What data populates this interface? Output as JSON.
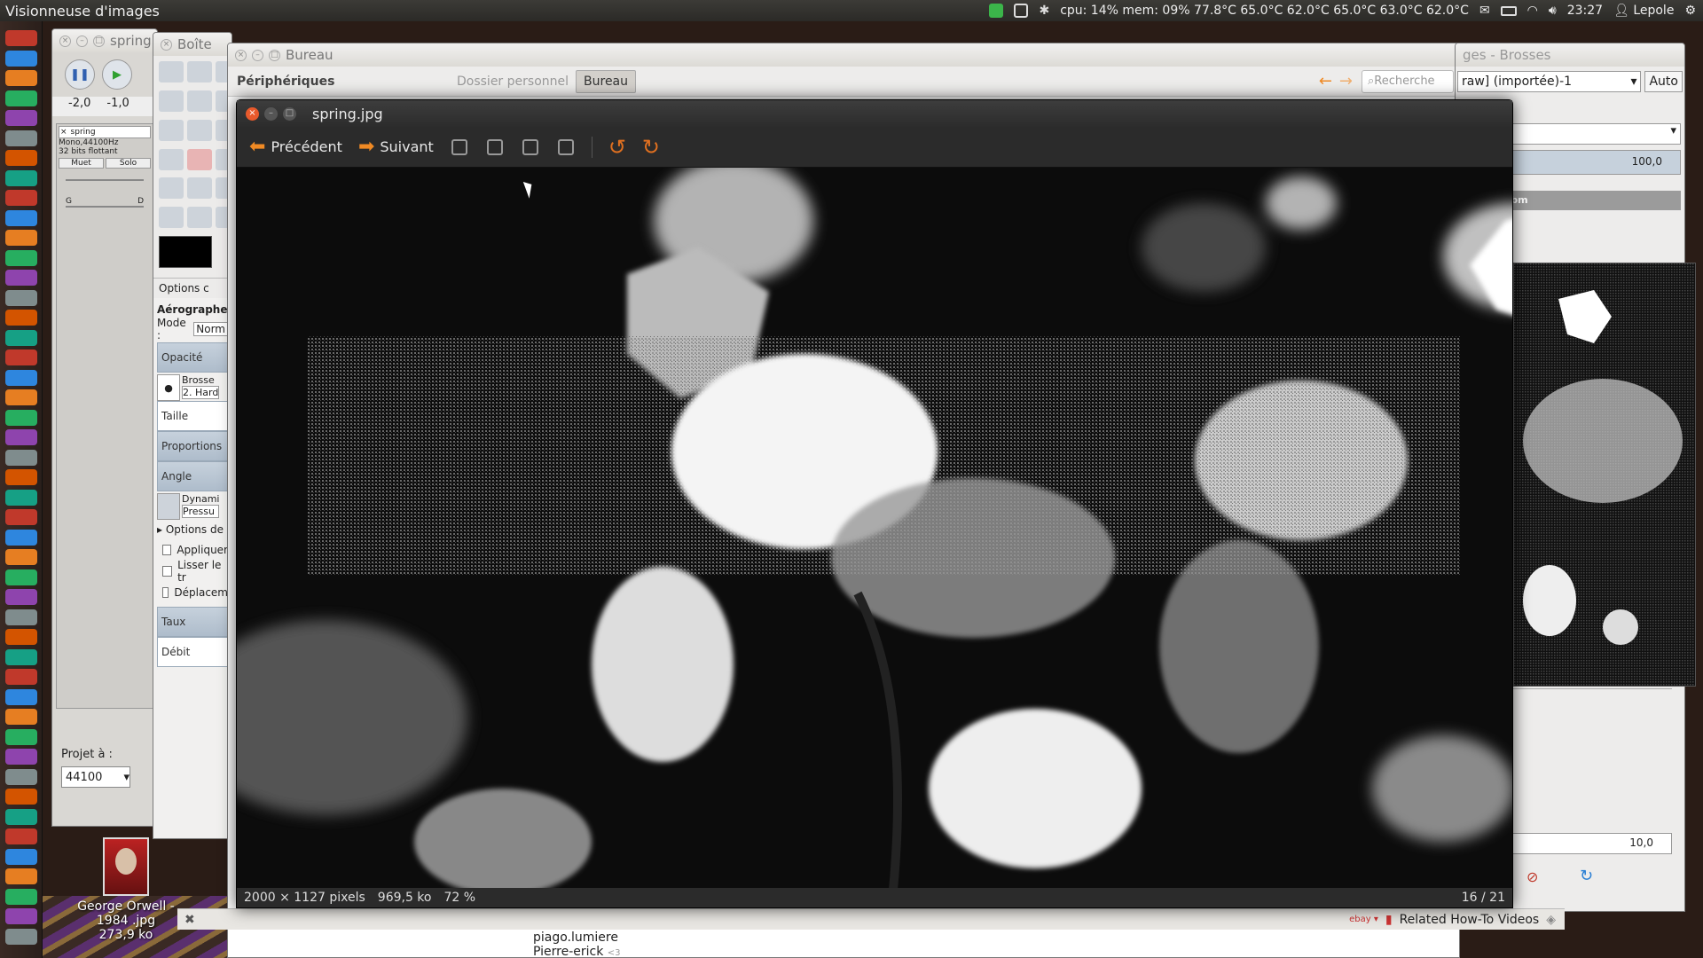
{
  "top_panel": {
    "app_name": "Visionneuse d'images",
    "system_stats": "cpu: 14% mem: 09% 77.8°C 65.0°C 62.0°C 65.0°C 63.0°C 62.0°C",
    "time": "23:27",
    "user": "Lepole"
  },
  "audacity": {
    "title": "spring",
    "ruler_left": "-2,0",
    "ruler_right": "-1,0",
    "track_name": "spring",
    "track_info_1": "Mono,44100Hz",
    "track_info_2": "32 bits flottant",
    "mute_label": "Muet",
    "solo_label": "Solo",
    "gain_left": "G",
    "gain_right": "D",
    "project_rate_label": "Projet à :",
    "project_rate_value": "44100"
  },
  "gimp_toolbox": {
    "title": "Boîte",
    "tool_options_label": "Options c",
    "tool_name": "Aérographe",
    "mode_label": "Mode :",
    "mode_value": "Norm",
    "opacity_label": "Opacité",
    "brush_label": "Brosse",
    "brush_value": "2. Hard",
    "size_label": "Taille",
    "aspect_label": "Proportions",
    "angle_label": "Angle",
    "dynamics_label": "Dynami",
    "dynamics_value": "Pressu",
    "dynamics_options_label": "Options de",
    "apply_jitter_label": "Appliquer",
    "smooth_label": "Lisser le tr",
    "motion_label": "Déplacem",
    "rate_label": "Taux",
    "flow_label": "Débit"
  },
  "file_manager": {
    "title": "Bureau",
    "devices_label": "Périphériques",
    "crumb_home": "Dossier personnel",
    "crumb_desktop": "Bureau",
    "search_placeholder": "Recherche",
    "list_item_1": "piago.lumiere",
    "list_item_2": "Pierre-erick",
    "list_item_2_suffix": "<3"
  },
  "gimp_right": {
    "title": "ges - Brosses",
    "image_menu": "raw] (importée)-1",
    "auto_label": "Auto",
    "opacity_value": "100,0",
    "layer_name": "ng.raw.pbm",
    "spacing_value": "10,0"
  },
  "desktop_icon": {
    "name_line_1": "George Orwell -",
    "name_line_2": "1984 .jpg",
    "size": "273,9 ko"
  },
  "browser_bar": {
    "related_label": "Related How-To Videos"
  },
  "viewer": {
    "title": "spring.jpg",
    "prev_label": "Précédent",
    "next_label": "Suivant",
    "dimensions": "2000 × 1127 pixels",
    "filesize": "969,5 ko",
    "zoom": "72 %",
    "position": "16 / 21"
  }
}
